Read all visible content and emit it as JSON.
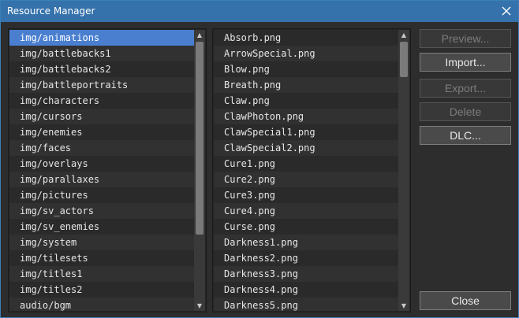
{
  "window": {
    "title": "Resource Manager"
  },
  "folders": {
    "selected_index": 0,
    "items": [
      "img/animations",
      "img/battlebacks1",
      "img/battlebacks2",
      "img/battleportraits",
      "img/characters",
      "img/cursors",
      "img/enemies",
      "img/faces",
      "img/overlays",
      "img/parallaxes",
      "img/pictures",
      "img/sv_actors",
      "img/sv_enemies",
      "img/system",
      "img/tilesets",
      "img/titles1",
      "img/titles2",
      "audio/bgm"
    ]
  },
  "files": {
    "items": [
      "Absorb.png",
      "ArrowSpecial.png",
      "Blow.png",
      "Breath.png",
      "Claw.png",
      "ClawPhoton.png",
      "ClawSpecial1.png",
      "ClawSpecial2.png",
      "Cure1.png",
      "Cure2.png",
      "Cure3.png",
      "Cure4.png",
      "Curse.png",
      "Darkness1.png",
      "Darkness2.png",
      "Darkness3.png",
      "Darkness4.png",
      "Darkness5.png"
    ]
  },
  "buttons": {
    "preview": "Preview...",
    "import": "Import...",
    "export": "Export...",
    "delete": "Delete",
    "dlc": "DLC...",
    "close": "Close"
  },
  "colors": {
    "titlebar": "#3572ab",
    "selection": "#4a7fd0",
    "background": "#2d2d2d"
  },
  "icons": {
    "close": "close-icon",
    "scroll_up": "arrow-up-icon",
    "scroll_down": "arrow-down-icon"
  }
}
